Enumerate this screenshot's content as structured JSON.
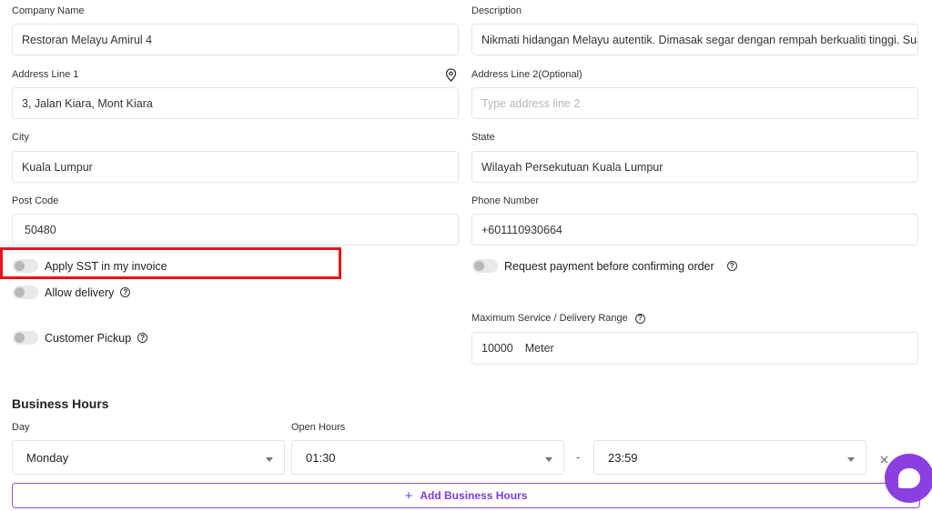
{
  "form": {
    "company_name": {
      "label": "Company Name",
      "value": "Restoran Melayu Amirul 4"
    },
    "description": {
      "label": "Description",
      "value": "Nikmati hidangan Melayu autentik. Dimasak segar dengan rempah berkualiti tinggi. Suasa"
    },
    "address1": {
      "label": "Address Line 1",
      "value": "3, Jalan Kiara, Mont Kiara",
      "icon": "location-pin-icon"
    },
    "address2": {
      "label": "Address Line 2(Optional)",
      "placeholder": "Type address line 2"
    },
    "city": {
      "label": "City",
      "value": "Kuala Lumpur"
    },
    "state": {
      "label": "State",
      "value": "Wilayah Persekutuan Kuala Lumpur"
    },
    "postcode": {
      "label": "Post Code",
      "value": "50480"
    },
    "phone": {
      "label": "Phone Number",
      "value": "+601110930664"
    }
  },
  "toggles": {
    "sst": {
      "label": "Apply SST in my invoice",
      "enabled": false
    },
    "request_payment": {
      "label": "Request payment before confirming order",
      "enabled": false
    },
    "delivery": {
      "label": "Allow delivery",
      "enabled": false
    },
    "pickup": {
      "label": "Customer Pickup",
      "enabled": false
    }
  },
  "range": {
    "label": "Maximum Service / Delivery Range",
    "value": "10000",
    "unit": "Meter"
  },
  "business_hours": {
    "title": "Business Hours",
    "day_label": "Day",
    "open_label": "Open Hours",
    "day": "Monday",
    "open_time": "01:30",
    "separator": "-",
    "close_time": "23:59",
    "add_label": "Add Business Hours"
  },
  "colors": {
    "accent": "#7d3be0",
    "highlight": "#e8121c"
  }
}
